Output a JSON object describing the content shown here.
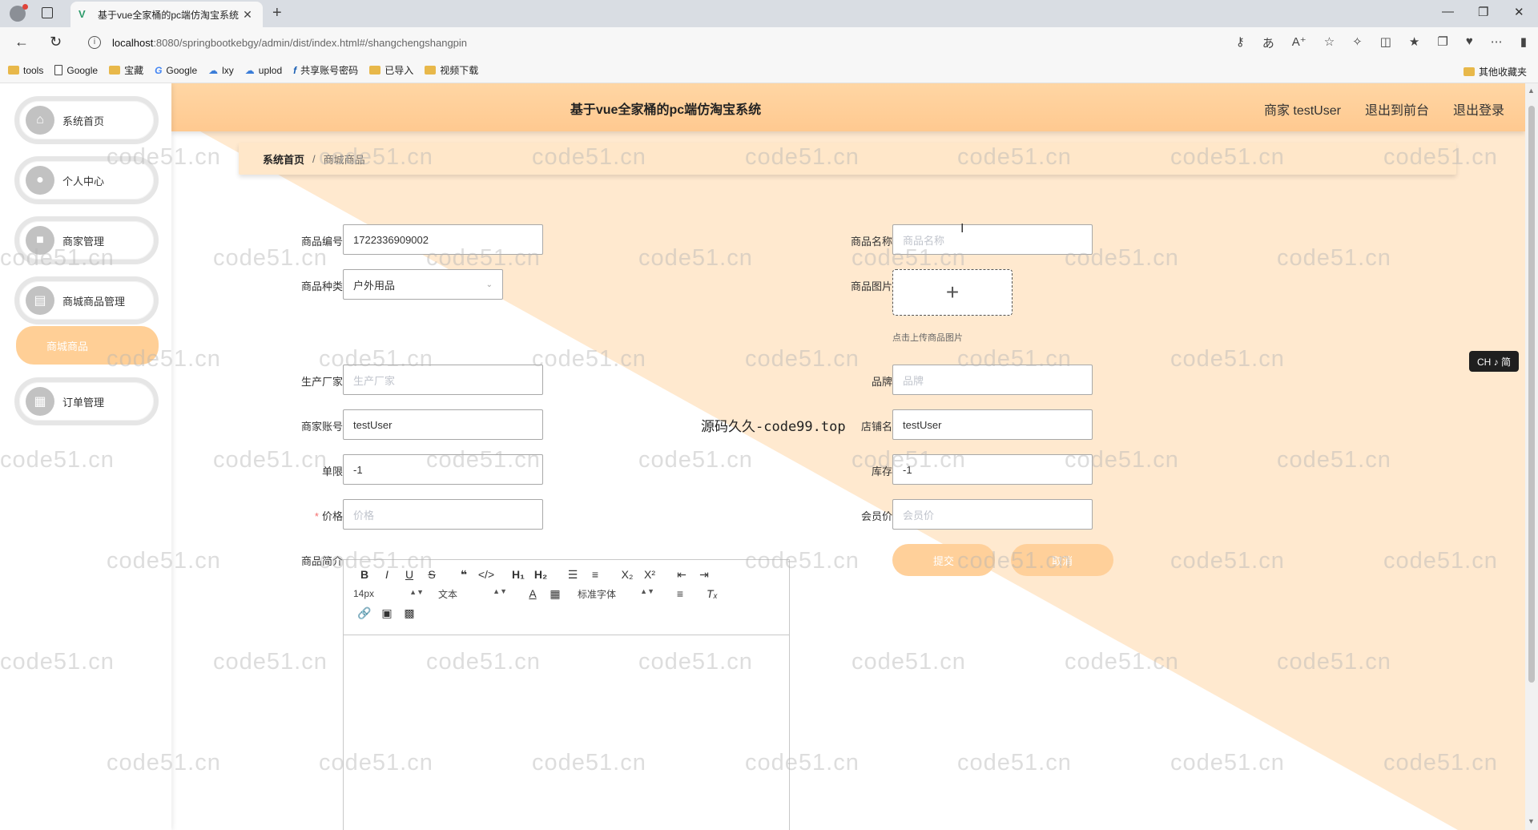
{
  "browser": {
    "tab_title": "基于vue全家桶的pc端仿淘宝系统",
    "tab_close": "✕",
    "new_tab": "+",
    "url_host": "localhost",
    "url_rest": ":8080/springbootkebgy/admin/dist/index.html#/shangchengshangpin",
    "bookmarks": [
      "tools",
      "Google",
      "宝藏",
      "Google",
      "lxy",
      "uplod",
      "共享账号密码",
      "已导入",
      "视频下载"
    ],
    "bookmarks_other": "其他收藏夹"
  },
  "sidebar": {
    "items": [
      {
        "label": "系统首页",
        "icon": "home-icon"
      },
      {
        "label": "个人中心",
        "icon": "user-icon"
      },
      {
        "label": "商家管理",
        "icon": "briefcase-icon"
      },
      {
        "label": "商城商品管理",
        "icon": "clipboard-icon"
      },
      {
        "label": "订单管理",
        "icon": "grid-icon"
      }
    ],
    "submenu_active": "商城商品"
  },
  "header": {
    "title": "基于vue全家桶的pc端仿淘宝系统",
    "user": "商家 testUser",
    "to_front": "退出到前台",
    "logout": "退出登录"
  },
  "breadcrumb": {
    "home": "系统首页",
    "separator": "/",
    "current": "商城商品"
  },
  "form": {
    "product_no": {
      "label": "商品编号",
      "value": "1722336909002"
    },
    "product_name": {
      "label": "商品名称",
      "placeholder": "商品名称"
    },
    "category": {
      "label": "商品种类",
      "value": "户外用品"
    },
    "image": {
      "label": "商品图片",
      "tip": "点击上传商品图片",
      "plus": "+"
    },
    "manufacturer": {
      "label": "生产厂家",
      "placeholder": "生产厂家"
    },
    "brand": {
      "label": "品牌",
      "placeholder": "品牌"
    },
    "merchant_account": {
      "label": "商家账号",
      "value": "testUser"
    },
    "shop_name": {
      "label": "店铺名",
      "value": "testUser"
    },
    "limit": {
      "label": "单限",
      "value": "-1"
    },
    "stock": {
      "label": "库存",
      "value": "-1"
    },
    "price": {
      "label": "价格",
      "placeholder": "价格",
      "required": "*"
    },
    "member_price": {
      "label": "会员价",
      "placeholder": "会员价"
    },
    "intro": {
      "label": "商品简介"
    },
    "submit": "提交",
    "cancel": "取消"
  },
  "editor": {
    "font_size": "14px",
    "format": "文本",
    "font_family": "标准字体"
  },
  "overlay": {
    "center_text": "源码久久-code99.top",
    "watermark": "code51.cn",
    "ime": "CH ♪ 简"
  },
  "colors": {
    "header_bg": "#ffc990",
    "button_bg": "#ffd09a",
    "breadcrumb_bg": "#ffe7c9"
  }
}
